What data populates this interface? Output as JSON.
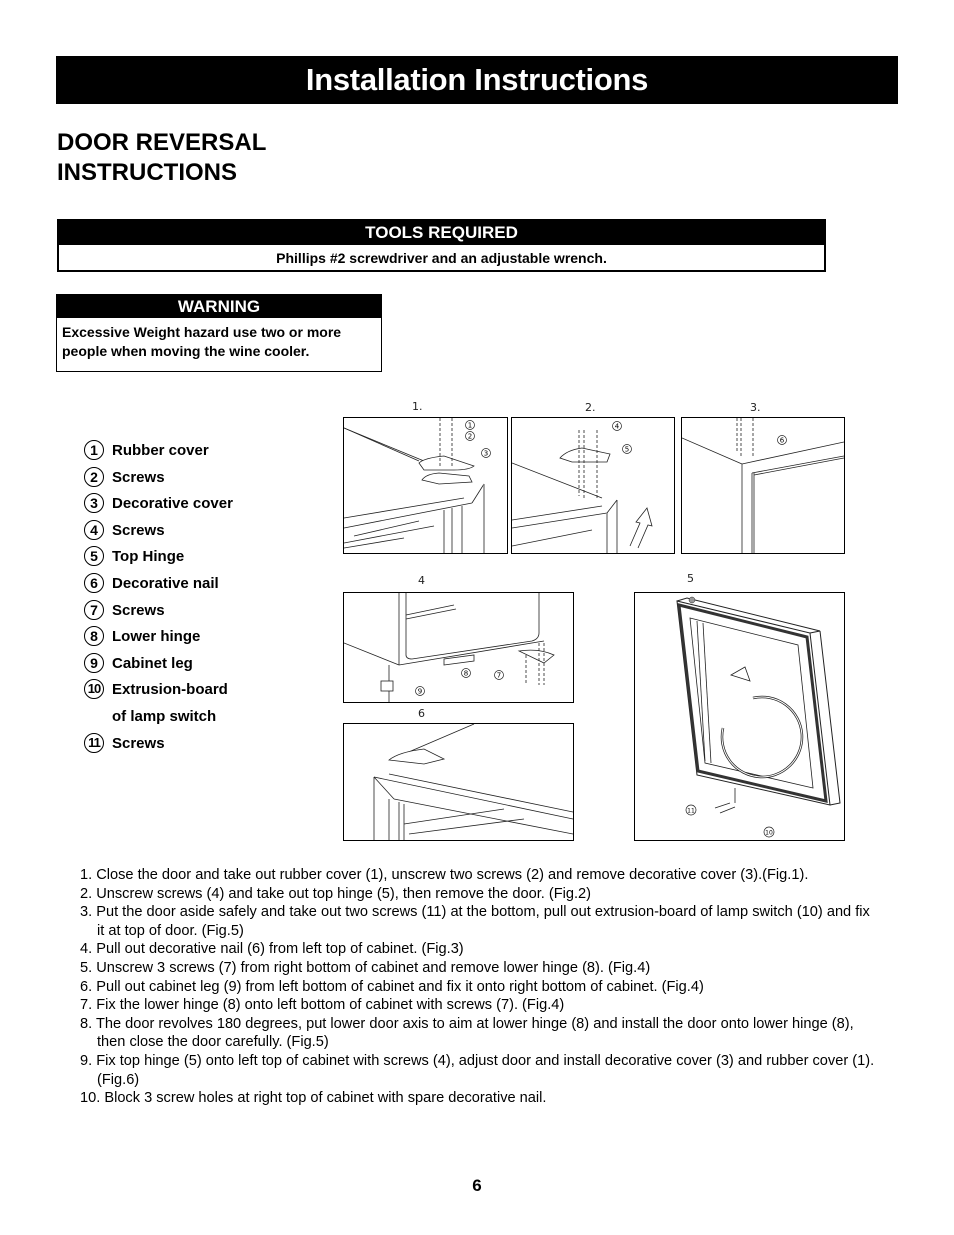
{
  "header": {
    "title": "Installation Instructions"
  },
  "section": {
    "heading_line1": "DOOR REVERSAL",
    "heading_line2": "INSTRUCTIONS"
  },
  "tools": {
    "title": "TOOLS REQUIRED",
    "text": "Phillips #2 screwdriver and an adjustable wrench."
  },
  "warning": {
    "title": "WARNING",
    "line1": "Excessive Weight hazard use two or more",
    "line2": "people when moving the wine cooler."
  },
  "legend": [
    {
      "num": "1",
      "label": "Rubber cover"
    },
    {
      "num": "2",
      "label": "Screws"
    },
    {
      "num": "3",
      "label": "Decorative cover"
    },
    {
      "num": "4",
      "label": "Screws"
    },
    {
      "num": "5",
      "label": "Top Hinge"
    },
    {
      "num": "6",
      "label": "Decorative nail"
    },
    {
      "num": "7",
      "label": "Screws"
    },
    {
      "num": "8",
      "label": "Lower hinge"
    },
    {
      "num": "9",
      "label": "Cabinet leg"
    },
    {
      "num": "10",
      "label": "Extrusion-board"
    },
    {
      "num": "",
      "label": "of lamp switch"
    },
    {
      "num": "11",
      "label": "Screws"
    }
  ],
  "figures": {
    "fig1": {
      "label": "1.",
      "callouts": [
        "1",
        "2",
        "3"
      ]
    },
    "fig2": {
      "label": "2.",
      "callouts": [
        "4",
        "5"
      ]
    },
    "fig3": {
      "label": "3.",
      "callouts": [
        "6"
      ]
    },
    "fig4": {
      "label": "4",
      "callouts": [
        "8",
        "7",
        "9"
      ]
    },
    "fig5": {
      "label": "5",
      "callouts": [
        "11",
        "10"
      ]
    },
    "fig6": {
      "label": "6",
      "callouts": []
    }
  },
  "steps": [
    "1. Close the door and take out rubber cover (1), unscrew two screws (2) and remove decorative cover (3).(Fig.1).",
    "2. Unscrew screws (4) and take out top hinge (5), then remove the door. (Fig.2)",
    "3. Put the door aside safely and take out two screws (11) at the bottom, pull out extrusion-board of lamp switch (10) and fix it at top of door. (Fig.5)",
    "4. Pull out decorative nail (6) from left top of cabinet. (Fig.3)",
    "5. Unscrew 3 screws (7) from right bottom of cabinet and remove lower hinge (8). (Fig.4)",
    "6. Pull out cabinet leg (9) from left bottom of cabinet and fix it onto right bottom of cabinet. (Fig.4)",
    "7. Fix the lower hinge (8) onto left bottom of cabinet with screws (7). (Fig.4)",
    "8. The door revolves 180 degrees, put lower door axis to aim at lower hinge (8) and install the door onto lower hinge (8), then close the door carefully. (Fig.5)",
    "9. Fix top hinge (5) onto left top of cabinet with screws (4), adjust door and install decorative cover (3) and rubber cover (1). (Fig.6)",
    "10. Block 3 screw holes at right top of cabinet with spare decorative nail."
  ],
  "footer": {
    "page_number": "6"
  }
}
